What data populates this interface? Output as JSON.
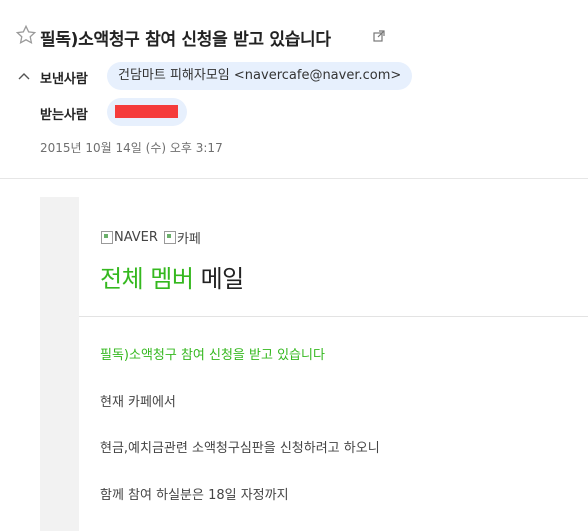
{
  "email": {
    "subject": "필독)소액청구 참여 신청을 받고 있습니다",
    "sender_label": "보낸사람",
    "sender": "건담마트 피해자모임 <navercafe@naver.com>",
    "recipient_label": "받는사람",
    "date": "2015년 10월 14일 (수) 오후 3:17"
  },
  "body": {
    "logo_naver_alt": "NAVER",
    "logo_cafe_alt": "카페",
    "title_green": "전체 멤버",
    "title_dark": " 메일",
    "lines": [
      "필독)소액청구 참여 신청을 받고 있습니다",
      "현재 카페에서",
      "현금,예치금관련 소액청구심판을 신청하려고 하오니",
      "함께 참여 하실분은 18일 자정까지"
    ]
  },
  "colors": {
    "accent_green": "#35b81f",
    "chip_bg": "#e7f0fd",
    "redaction": "#f53b3b"
  },
  "icons": {
    "star": "star-outline-icon",
    "popout": "external-link-icon",
    "fold": "chevron-up-icon"
  }
}
